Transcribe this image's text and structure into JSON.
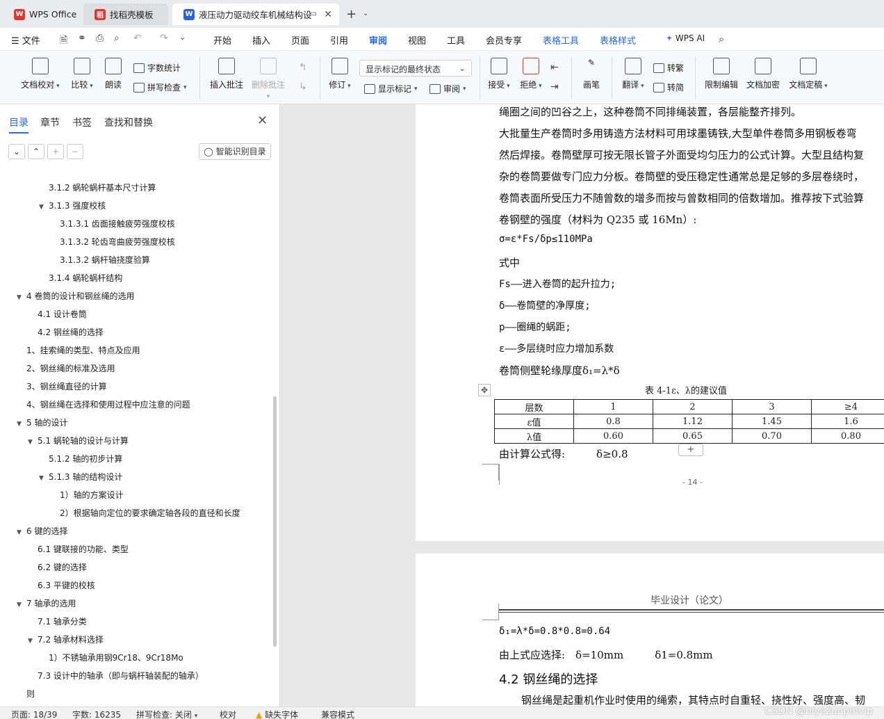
{
  "tabs": [
    {
      "label": "WPS Office"
    },
    {
      "label": "找稻壳模板"
    },
    {
      "label": "液压动力驱动绞车机械结构设"
    }
  ],
  "menu": {
    "file": "文件",
    "items": [
      "开始",
      "插入",
      "页面",
      "引用",
      "审阅",
      "视图",
      "工具",
      "会员专享",
      "表格工具",
      "表格样式"
    ],
    "active": "审阅",
    "wps_ai": "WPS AI"
  },
  "ribbon": {
    "doc_check": "文档校对",
    "compare": "比较",
    "read_aloud": "朗读",
    "word_count": "字数统计",
    "spell_check": "拼写检查",
    "insert_comment": "插入批注",
    "delete_comment": "删除批注",
    "revise": "修订",
    "mark_state": "显示标记的最终状态",
    "show_marks": "显示标记",
    "review": "审阅",
    "accept": "接受",
    "reject": "拒绝",
    "pen": "画笔",
    "translate": "翻译",
    "to_traditional": "转繁",
    "to_simplified": "转简",
    "restrict_edit": "限制编辑",
    "encrypt": "文档加密",
    "finalize": "文档定稿"
  },
  "sidebar": {
    "tabs": [
      "目录",
      "章节",
      "书签",
      "查找和替换"
    ],
    "smart_toc": "智能识别目录",
    "toc": [
      {
        "text": "3.1.2 蜗轮蜗杆基本尺寸计算",
        "level": 3,
        "toggle": ""
      },
      {
        "text": "3.1.3 强度校核",
        "level": 3,
        "toggle": "▼"
      },
      {
        "text": "3.1.3.1 齿面接触疲劳强度校核",
        "level": 4,
        "toggle": ""
      },
      {
        "text": "3.1.3.2 轮齿弯曲疲劳强度校核",
        "level": 4,
        "toggle": ""
      },
      {
        "text": "3.1.3.2 蜗杆轴挠度验算",
        "level": 4,
        "toggle": ""
      },
      {
        "text": "3.1.4 蜗轮蜗杆结构",
        "level": 3,
        "toggle": ""
      },
      {
        "text": "4 卷筒的设计和钢丝绳的选用",
        "level": 1,
        "toggle": "▼"
      },
      {
        "text": "4.1 设计卷筒",
        "level": 2,
        "toggle": ""
      },
      {
        "text": "4.2 钢丝绳的选择",
        "level": 2,
        "toggle": ""
      },
      {
        "text": "1、挂索绳的类型、特点及应用",
        "level": 1,
        "toggle": ""
      },
      {
        "text": "2、钢丝绳的标准及选用",
        "level": 1,
        "toggle": ""
      },
      {
        "text": "3、钢丝绳直径的计算",
        "level": 1,
        "toggle": ""
      },
      {
        "text": "4、钢丝绳在选择和使用过程中应注意的问题",
        "level": 1,
        "toggle": ""
      },
      {
        "text": "5 轴的设计",
        "level": 1,
        "toggle": "▼"
      },
      {
        "text": "5.1 蜗轮轴的设计与计算",
        "level": 2,
        "toggle": "▼"
      },
      {
        "text": "5.1.2 轴的初步计算",
        "level": 3,
        "toggle": ""
      },
      {
        "text": "5.1.3 轴的结构设计",
        "level": 3,
        "toggle": "▼"
      },
      {
        "text": "1）轴的方案设计",
        "level": 4,
        "toggle": ""
      },
      {
        "text": "2）根据轴向定位的要求确定轴各段的直径和长度",
        "level": 4,
        "toggle": ""
      },
      {
        "text": "6 键的选择",
        "level": 1,
        "toggle": "▼"
      },
      {
        "text": "6.1 键联接的功能、类型",
        "level": 2,
        "toggle": ""
      },
      {
        "text": "6.2 键的选择",
        "level": 2,
        "toggle": ""
      },
      {
        "text": "6.3 平键的校核",
        "level": 2,
        "toggle": ""
      },
      {
        "text": "7 轴承的选用",
        "level": 1,
        "toggle": "▼"
      },
      {
        "text": "7.1 轴承分类",
        "level": 2,
        "toggle": ""
      },
      {
        "text": "7.2 轴承材料选择",
        "level": 2,
        "toggle": "▼"
      },
      {
        "text": "1）不锈轴承用钢9Cr18、9Cr18Mo",
        "level": 3,
        "toggle": ""
      },
      {
        "text": "7.3 设计中的轴承（即与蜗杆轴装配的轴承）",
        "level": 2,
        "toggle": ""
      },
      {
        "text": "则",
        "level": 1,
        "toggle": ""
      }
    ]
  },
  "page1": {
    "lines": [
      "绳圈之间的凹谷之上，这种卷筒不同排绳装置，各层能整齐排列。",
      "大批量生产卷筒时多用铸造方法材料可用球墨铸铁,大型单件卷筒多用钢板卷弯",
      "然后焊接。卷筒壁厚可按无限长管子外面受均匀压力的公式计算。大型且结构复",
      "杂的卷筒要做专门应力分板。卷筒壁的受压稳定性通常总是足够的多层卷绕时，",
      "卷筒表面所受压力不随曾数的增多而按与曾数相同的倍数增加。推荐按下式验算",
      "卷钢壁的强度（材料为 Q235 或 16Mn）:",
      "σ=ε*Fs/δp≤110MPa",
      "式中",
      "Fs——进入卷筒的起升拉力;",
      "δ——卷筒壁的净厚度;",
      "p——圈绳的蜗距;",
      "ε——多层绕时应力增加系数",
      "卷筒侧壁轮缘厚度δ₁=λ*δ"
    ],
    "table_caption": "表 4-1ε、λ的建议值",
    "table": [
      [
        "层数",
        "1",
        "2",
        "3",
        "≥4"
      ],
      [
        "ε值",
        "0.8",
        "1.12",
        "1.45",
        "1.6"
      ],
      [
        "λ值",
        "0.60",
        "0.65",
        "0.70",
        "0.80"
      ]
    ],
    "result": "由计算公式得:　　　δ≥0.8",
    "page_number": "- 14 -"
  },
  "page2": {
    "header": "毕业设计（论文）",
    "line1": "δ₁=λ*δ=0.8*0.8=0.64",
    "line2": "由上式应选择:　δ=10mm　　　δ1=0.8mm",
    "heading": "4.2 钢丝绳的选择",
    "line3": "钢丝绳是起重机作业时使用的绳索，其特点时自重轻、挠性好、强度高、韧"
  },
  "statusbar": {
    "page": "页面: 18/39",
    "words": "字数: 16235",
    "spell": "拼写检查: 关闭",
    "proof": "校对",
    "missing_font": "缺失字体",
    "compat": "兼容模式",
    "watermark": "CSDN @biyezuopinvip"
  },
  "colors": {
    "accent": "#2468f2",
    "wps_red": "#e8322d",
    "doc_blue": "#2b62e4"
  }
}
